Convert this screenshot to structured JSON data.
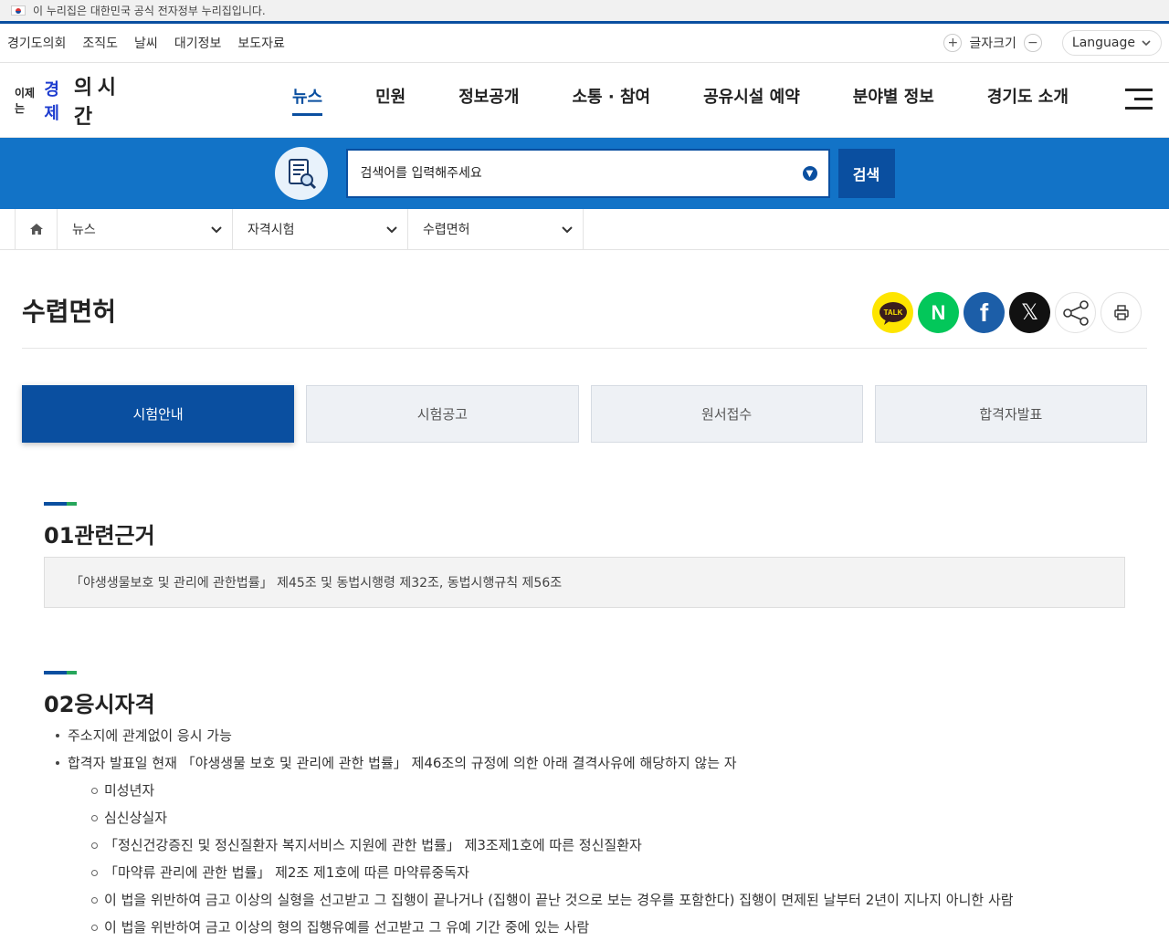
{
  "gov_notice": "이 누리집은 대한민국 공식 전자정부 누리집입니다.",
  "util": {
    "links": [
      "경기도의회",
      "조직도",
      "날씨",
      "대기정보",
      "보도자료"
    ],
    "font_size_label": "글자크기",
    "language_label": "Language"
  },
  "logo": {
    "part1": "이제는",
    "part2": "경제",
    "part3": "의 시간"
  },
  "gnb": {
    "items": [
      "뉴스",
      "민원",
      "정보공개",
      "소통 · 참여",
      "공유시설 예약",
      "분야별 정보",
      "경기도 소개"
    ]
  },
  "search": {
    "placeholder": "검색어를 입력해주세요",
    "button": "검색"
  },
  "breadcrumb": {
    "level1": "뉴스",
    "level2": "자격시험",
    "level3": "수렵면허"
  },
  "page": {
    "title": "수렵면허"
  },
  "share": {
    "kakao": "TALK",
    "naver": "N",
    "facebook": "f",
    "x": "𝕏"
  },
  "tabs": [
    "시험안내",
    "시험공고",
    "원서접수",
    "합격자발표"
  ],
  "section1": {
    "title": "01관련근거",
    "text": "「야생생물보호 및 관리에 관한법률」 제45조 및 동법시행령 제32조, 동법시행규칙 제56조"
  },
  "section2": {
    "title": "02응시자격",
    "items": [
      "주소지에 관계없이 응시 가능",
      "합격자 발표일 현재 「야생생물 보호 및 관리에 관한 법률」 제46조의 규정에 의한 아래 결격사유에 해당하지 않는 자"
    ],
    "subitems": [
      "미성년자",
      "심신상실자",
      "「정신건강증진 및 정신질환자 복지서비스 지원에 관한 법률」 제3조제1호에 따른 정신질환자",
      "「마약류 관리에 관한 법률」 제2조 제1호에 따른 마약류중독자",
      "이 법을 위반하여 금고 이상의 실형을 선고받고 그 집행이 끝나거나 (집행이 끝난 것으로 보는 경우를 포함한다) 집행이 면제된 날부터 2년이 지나지 아니한 사람",
      "이 법을 위반하여 금고 이상의 형의 집행유예를 선고받고 그 유예 기간 중에 있는 사람"
    ]
  },
  "colors": {
    "primary": "#0a4fa0",
    "search_band": "#1273c7",
    "accent_green": "#26a65b"
  }
}
